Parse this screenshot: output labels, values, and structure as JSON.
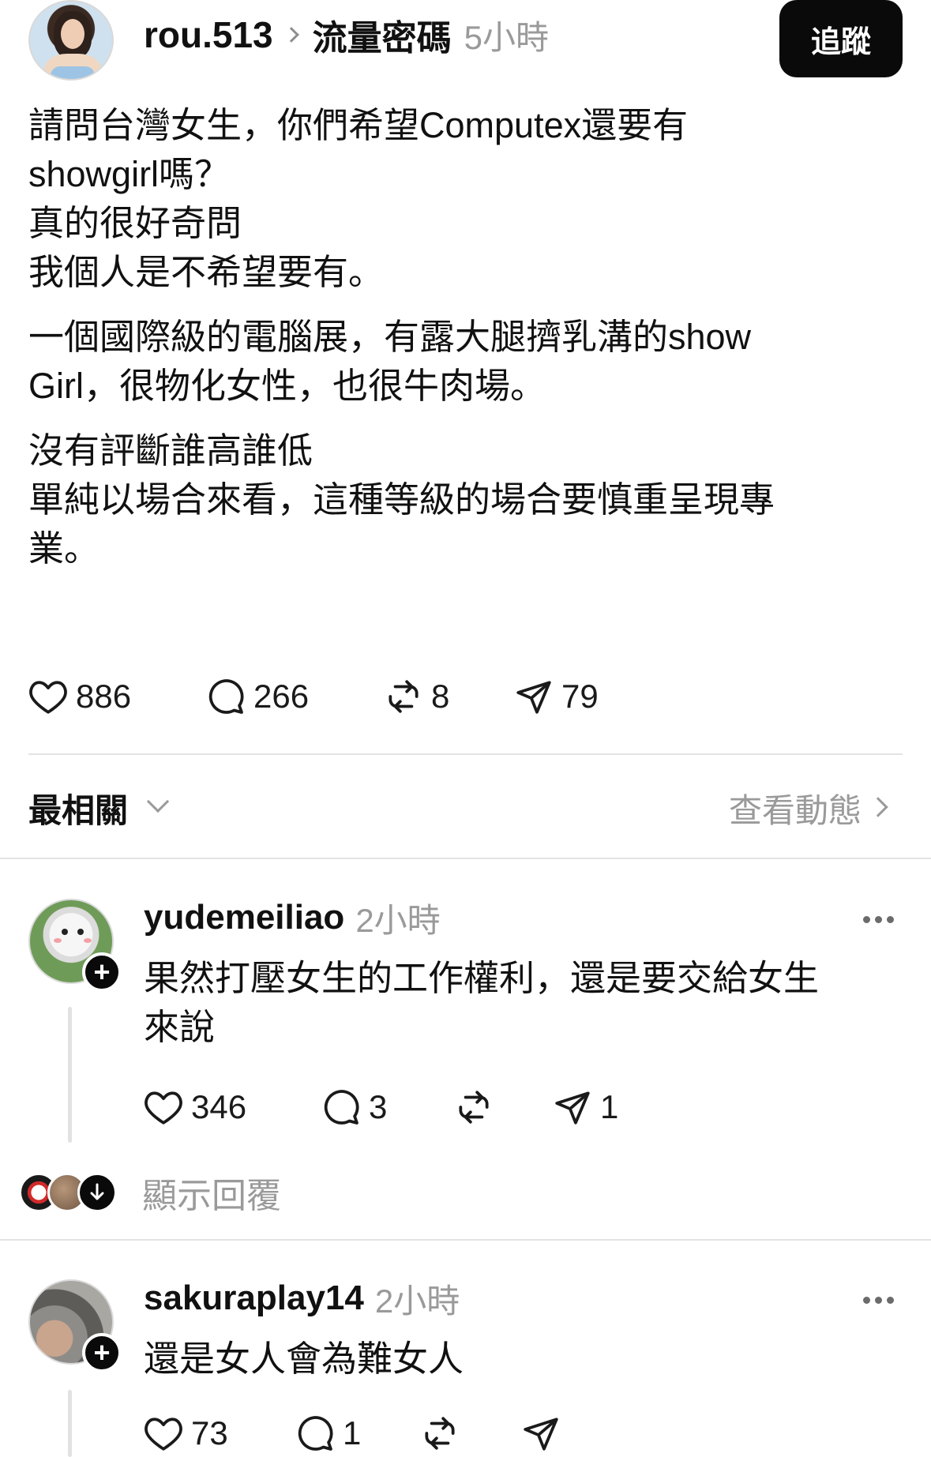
{
  "post": {
    "username": "rou.513",
    "topic": "流量密碼",
    "time": "5小時",
    "follow_label": "追蹤",
    "paragraphs": [
      "請問台灣女生，你們希望Computex還要有\nshowgirl嗎？\n真的很好奇問\n我個人是不希望要有。",
      "一個國際級的電腦展，有露大腿擠乳溝的show\nGirl，很物化女性，也很牛肉場。",
      "沒有評斷誰高誰低\n單純以場合來看，這種等級的場合要慎重呈現專\n業。"
    ],
    "likes": "886",
    "comments": "266",
    "reposts": "8",
    "shares": "79"
  },
  "sort": {
    "label": "最相關",
    "view_activity": "查看動態"
  },
  "comments": [
    {
      "username": "yudemeiliao",
      "time": "2小時",
      "text": "果然打壓女生的工作權利，還是要交給女生\n來說",
      "likes": "346",
      "replies": "3",
      "reposts": "",
      "shares": "1"
    },
    {
      "username": "sakuraplay14",
      "time": "2小時",
      "text": "還是女人會為難女人",
      "likes": "73",
      "replies": "1",
      "reposts": "",
      "shares": ""
    }
  ],
  "show_replies_label": "顯示回覆",
  "icons": {
    "like": "heart-icon",
    "comment": "comment-bubble-icon",
    "repost": "repost-icon",
    "share": "send-icon",
    "more": "more-dots-icon",
    "follow_plus": "plus-icon",
    "expand": "arrow-down-icon"
  }
}
